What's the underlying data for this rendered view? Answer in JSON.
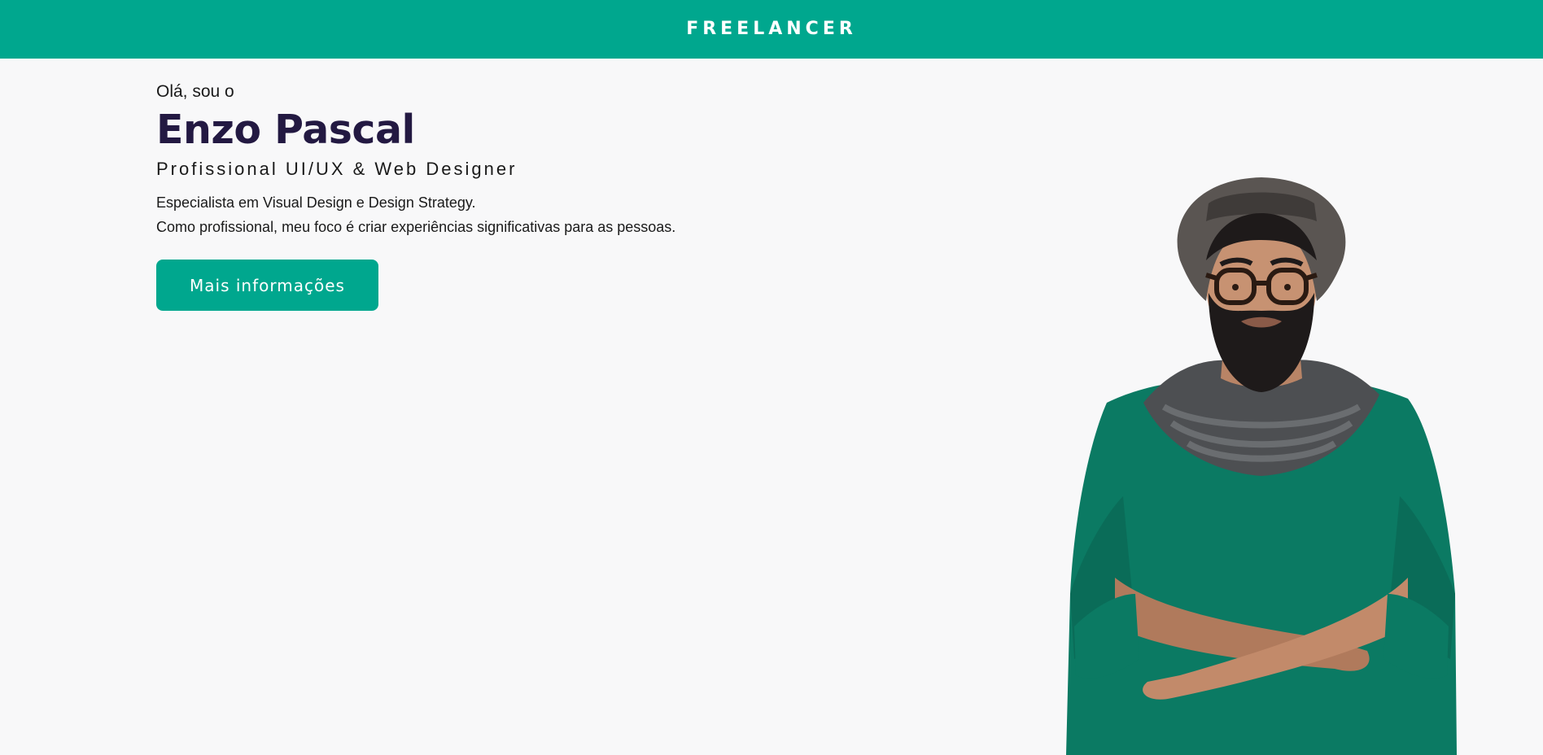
{
  "header": {
    "brand": "FREELANCER"
  },
  "hero": {
    "greeting": "Olá, sou o",
    "name": "Enzo Pascal",
    "role": "Profissional UI/UX & Web Designer",
    "description_line1": "Especialista em Visual Design e Design Strategy.",
    "description_line2": "Como profissional, meu foco é criar experiências significativas para as pessoas.",
    "cta_label": "Mais informações"
  },
  "colors": {
    "accent": "#00a78e",
    "name_text": "#231942",
    "background": "#f8f8f9",
    "sweater": "#0b7a63"
  },
  "image": {
    "portrait": "bearded-man-hat-glasses-scarf-green-sweater-arms-crossed"
  }
}
